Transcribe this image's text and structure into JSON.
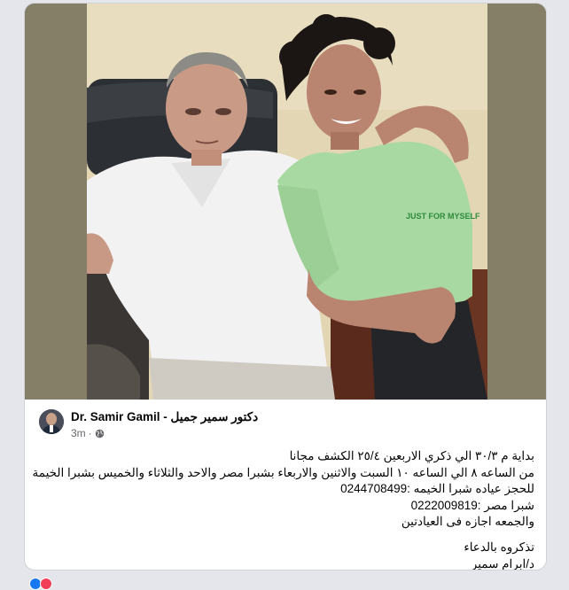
{
  "post": {
    "author": "Dr. Samir Gamil - دكتور سمير جميل",
    "time": "3m",
    "separator": "·",
    "privacy_icon": "globe-icon",
    "photo_alt": "photo",
    "lines": [
      "بداية م ٣٠/٣ الي ذكري الاربعين ٢٥/٤ الكشف مجانا",
      "من الساعه ٨ الي الساعه ١٠ السبت والاثنين والاربعاء بشبرا مصر والاحد والثلاثاء والخميس بشبرا الخيمة",
      "للحجز عياده شبرا الخيمه :0244708499",
      "شبرا مصر :0222009819",
      "والجمعه اجازه فى العيادتين"
    ],
    "closing": [
      "تذكروه بالدعاء",
      "د/ابرام سمير"
    ]
  },
  "colors": {
    "card": "#ffffff",
    "page": "#e4e6eb",
    "text": "#050505",
    "muted": "#65676b",
    "photo_wall": "#e2d6b4",
    "photo_side": "#867f68"
  }
}
